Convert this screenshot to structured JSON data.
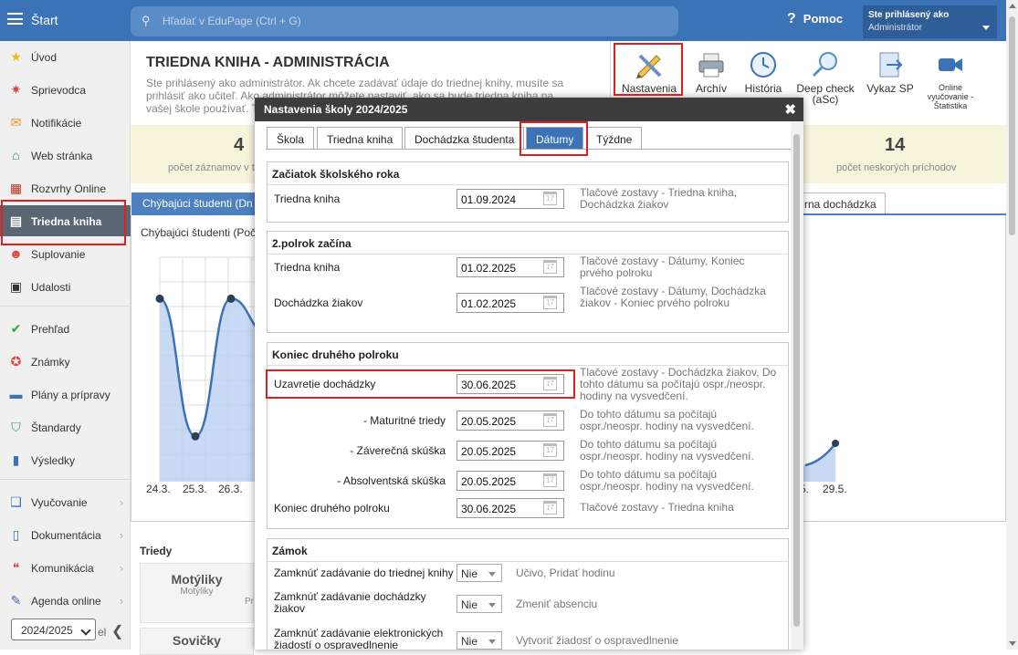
{
  "topbar": {
    "start_label": "Štart",
    "search_placeholder": "Hľadať v EduPage (Ctrl + G)",
    "help_label": "Pomoc",
    "user_line1": "Ste prihlásený ako",
    "user_line2": "Administrátor"
  },
  "sidebar": {
    "items": [
      {
        "label": "Úvod",
        "icon": "star-icon"
      },
      {
        "label": "Sprievodca",
        "icon": "wand-icon"
      },
      {
        "label": "Notifikácie",
        "icon": "envelope-icon"
      },
      {
        "label": "Web stránka",
        "icon": "home-icon"
      },
      {
        "label": "Rozvrhy Online",
        "icon": "calendar-grid-icon"
      },
      {
        "label": "Triedna kniha",
        "icon": "book-icon"
      },
      {
        "label": "Suplovanie",
        "icon": "person-icon"
      },
      {
        "label": "Udalosti",
        "icon": "calendar-icon"
      },
      {
        "label": "Prehľad",
        "icon": "check-icon"
      },
      {
        "label": "Známky",
        "icon": "grade-icon"
      },
      {
        "label": "Plány a prípravy",
        "icon": "briefcase-icon"
      },
      {
        "label": "Štandardy",
        "icon": "shield-check-icon"
      },
      {
        "label": "Výsledky",
        "icon": "bar-chart-icon"
      },
      {
        "label": "Vyučovanie",
        "icon": "open-book-icon"
      },
      {
        "label": "Dokumentácia",
        "icon": "document-icon"
      },
      {
        "label": "Komunikácia",
        "icon": "chat-icon"
      },
      {
        "label": "Agenda online",
        "icon": "pen-icon"
      }
    ],
    "year": "2024/2025",
    "partial_label": "el"
  },
  "page": {
    "title": "TRIEDNA KNIHA - ADMINISTRÁCIA",
    "desc": "Ste prihlásený ako administrátor. Ak chcete zadávať údaje do triednej knihy, musíte sa prihlásiť ako učiteľ. Ako administrátor môžete nastaviť, ako sa bude triedna kniha na vašej škole používať. Taktiež"
  },
  "toolbar": [
    {
      "label": "Nastavenia",
      "icon": "pencil-ruler-icon"
    },
    {
      "label": "Archív",
      "icon": "printer-icon"
    },
    {
      "label": "História",
      "icon": "clock-icon"
    },
    {
      "label": "Deep check (aSc)",
      "icon": "magnifier-icon"
    },
    {
      "label": "Vykaz SP",
      "icon": "export-icon"
    },
    {
      "label": "Online vyučovanie - Štatistika",
      "icon": "video-icon"
    }
  ],
  "stats": [
    {
      "value": "4",
      "label": "počet záznamov v t"
    },
    {
      "value": "14",
      "label": "počet neskorých príchodov"
    }
  ],
  "tabs": {
    "missing": "Chýbajúci študenti (Dn",
    "attendance": "rna dochádzka"
  },
  "chart_data": {
    "type": "line",
    "title": "Chýbajúci študenti (Poč",
    "categories": [
      "24.3.",
      "25.3.",
      "26.3.",
      "…",
      "5.",
      "29.5."
    ],
    "series": [
      {
        "values": [
          5,
          1,
          5,
          4,
          0.5,
          1.8
        ]
      }
    ]
  },
  "classes": {
    "heading": "Triedy",
    "cards": [
      {
        "name": "Motýliky",
        "sub": "Motýliky",
        "extra": "Pr"
      },
      {
        "name": "Sovičky"
      }
    ]
  },
  "dialog": {
    "title": "Nastavenia školy 2024/2025",
    "tabs": [
      "Škola",
      "Triedna kniha",
      "Dochádzka študenta",
      "Dátumy",
      "Týždne"
    ],
    "sections": {
      "start": {
        "heading": "Začiatok školského roka",
        "rows": [
          {
            "label": "Triedna kniha",
            "value": "01.09.2024",
            "desc": "Tlačové zostavy - Triedna kniha, Dochádzka žiakov"
          }
        ]
      },
      "second": {
        "heading": "2.polrok začína",
        "rows": [
          {
            "label": "Triedna kniha",
            "value": "01.02.2025",
            "desc": "Tlačové zostavy - Dátumy, Koniec prvého polroku"
          },
          {
            "label": "Dochádzka žiakov",
            "value": "01.02.2025",
            "desc": "Tlačové zostavy - Dátumy, Dochádzka žiakov - Koniec prvého polroku"
          }
        ]
      },
      "end": {
        "heading": "Koniec druhého polroku",
        "rows": [
          {
            "label": "Uzavretie dochádzky",
            "value": "30.06.2025",
            "desc": "Tlačové zostavy - Dochádzka žiakov, Do tohto dátumu sa počítajú ospr./neospr. hodiny na vysvedčení."
          },
          {
            "label": "- Maturitné triedy",
            "value": "20.05.2025",
            "desc": "Do tohto dátumu sa počítajú ospr./neospr. hodiny na vysvedčení."
          },
          {
            "label": "- Záverečná skúška",
            "value": "20.05.2025",
            "desc": "Do tohto dátumu sa počítajú ospr./neospr. hodiny na vysvedčení."
          },
          {
            "label": "- Absolventská skúška",
            "value": "20.05.2025",
            "desc": "Do tohto dátumu sa počítajú ospr./neospr. hodiny na vysvedčení."
          },
          {
            "label": "Koniec druhého polroku",
            "value": "30.06.2025",
            "desc": "Tlačové zostavy - Triedna kniha"
          }
        ]
      },
      "lock": {
        "heading": "Zámok",
        "rows": [
          {
            "label": "Zamknúť zadávanie do triednej knihy",
            "value": "Nie",
            "desc": "Učivo, Pridať hodinu"
          },
          {
            "label": "Zamknúť zadávanie dochádzky žiakov",
            "value": "Nie",
            "desc": "Zmeniť absenciu"
          },
          {
            "label": "Zamknúť zadávanie elektronických žiadostí o ospravedlnenie",
            "value": "Nie",
            "desc": "Vytvoriť žiadosť o ospravedlnenie"
          }
        ]
      }
    }
  },
  "colors": {
    "accent": "#3c73b6",
    "highlight": "#e02020",
    "dialog_header": "#3d3d3d"
  }
}
